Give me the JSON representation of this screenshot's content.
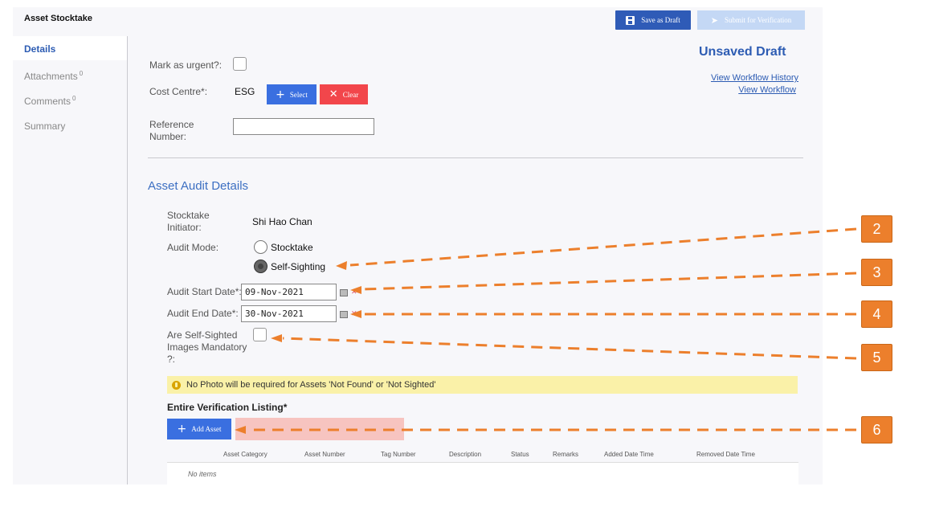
{
  "app": {
    "title": "Asset Stocktake"
  },
  "toolbar": {
    "save_draft_label": "Save as Draft",
    "submit_label": "Submit for Verification"
  },
  "sidebar": {
    "items": [
      {
        "label": "Details",
        "count": ""
      },
      {
        "label": "Attachments",
        "count": "0"
      },
      {
        "label": "Comments",
        "count": "0"
      },
      {
        "label": "Summary",
        "count": ""
      }
    ]
  },
  "header": {
    "status": "Unsaved Draft",
    "view_workflow_history": "View Workflow History",
    "view_workflow": "View Workflow"
  },
  "form": {
    "mark_urgent_label": "Mark as urgent?:",
    "cost_centre_label": "Cost Centre*:",
    "cost_centre_value": "ESG",
    "select_label": "Select",
    "clear_label": "Clear",
    "reference_label_line1": "Reference",
    "reference_label_line2": "Number:",
    "reference_value": ""
  },
  "audit": {
    "section_title": "Asset Audit Details",
    "initiator_label_line1": "Stocktake",
    "initiator_label_line2": "Initiator:",
    "initiator_value": "Shi Hao Chan",
    "mode_label": "Audit Mode:",
    "mode_options": [
      "Stocktake",
      "Self-Sighting"
    ],
    "mode_selected": "Self-Sighting",
    "start_label": "Audit Start Date*:",
    "start_value": "09-Nov-2021",
    "end_label": "Audit End Date*:",
    "end_value": "30-Nov-2021",
    "images_label_line1": "Are Self-Sighted",
    "images_label_line2": "Images Mandatory",
    "images_label_line3": "?:"
  },
  "notice": {
    "text": "No Photo will be required for Assets 'Not Found' or 'Not Sighted'"
  },
  "listing": {
    "title": "Entire Verification Listing*",
    "add_label": "Add Asset",
    "columns": [
      "Asset Category",
      "Asset Number",
      "Tag Number",
      "Description",
      "Status",
      "Remarks",
      "Added Date Time",
      "Removed Date Time"
    ],
    "empty_text": "No items"
  },
  "annotations": {
    "badges": [
      "2",
      "3",
      "4",
      "5",
      "6"
    ],
    "color": "#ec7f2c"
  }
}
